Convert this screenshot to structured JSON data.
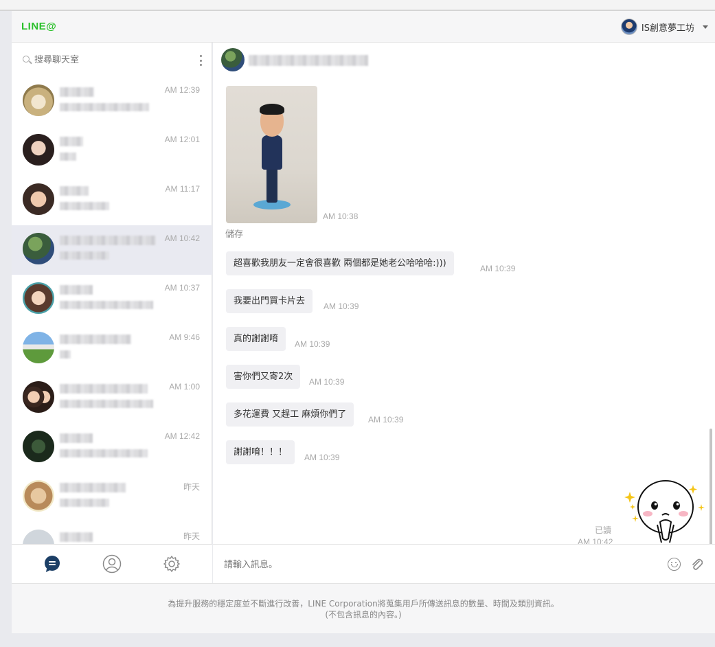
{
  "app": {
    "logo": "LINE@"
  },
  "account": {
    "name": "IS創意夢工坊"
  },
  "search": {
    "placeholder": "搜尋聊天室"
  },
  "chats": [
    {
      "time": "AM 12:39"
    },
    {
      "time": "AM 12:01"
    },
    {
      "time": "AM 11:17"
    },
    {
      "time": "AM 10:42"
    },
    {
      "time": "AM 10:37"
    },
    {
      "time": "AM 9:46"
    },
    {
      "time": "AM 1:00"
    },
    {
      "time": "AM 12:42"
    },
    {
      "time": "昨天"
    },
    {
      "time": "昨天"
    }
  ],
  "conversation": {
    "photo_time": "AM 10:38",
    "save_label": "儲存",
    "messages": [
      {
        "text": "超喜歡我朋友一定會很喜歡 兩個都是她老公哈哈哈:)))",
        "time": "AM 10:39"
      },
      {
        "text": "我要出門買卡片去",
        "time": "AM 10:39"
      },
      {
        "text": "真的謝謝唷",
        "time": "AM 10:39"
      },
      {
        "text": "害你們又寄2次",
        "time": "AM 10:39"
      },
      {
        "text": "多花運費 又趕工 麻煩你們了",
        "time": "AM 10:39"
      },
      {
        "text": "謝謝唷！！！",
        "time": "AM 10:39"
      }
    ],
    "read_label": "已讀",
    "sticker_time": "AM 10:42"
  },
  "composer": {
    "placeholder": "請輸入訊息。"
  },
  "footer": {
    "line1": "為提升服務的穩定度並不斷進行改善，LINE Corporation將蒐集用戶所傳送訊息的數量、時間及類別資訊。",
    "line2": "(不包含訊息的內容。)"
  },
  "colors": {
    "brand": "#2bc02b",
    "active_row": "#e9eaf1",
    "bubble": "#f0f0f3"
  }
}
